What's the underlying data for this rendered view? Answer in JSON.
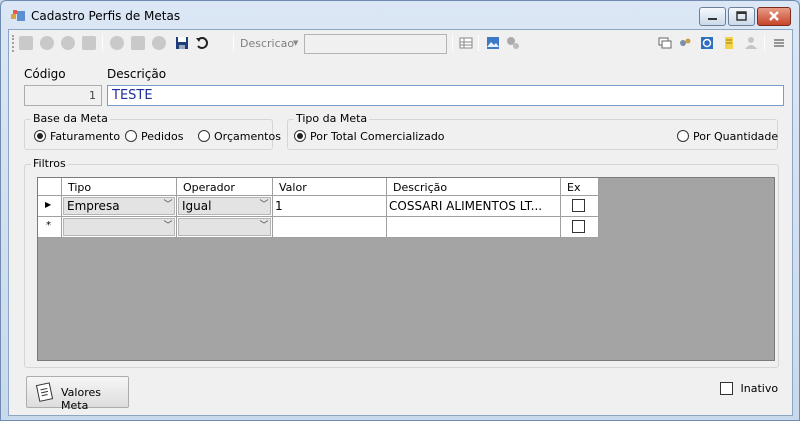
{
  "window": {
    "title": "Cadastro Perfis de Metas"
  },
  "toolbar": {
    "search_field_label": "Descricao",
    "search_field_value": ""
  },
  "form": {
    "codigo_label": "Código",
    "descricao_label": "Descrição",
    "codigo_value": "1",
    "descricao_value": "TESTE"
  },
  "base_meta": {
    "title": "Base da Meta",
    "options": [
      "Faturamento",
      "Pedidos",
      "Orçamentos"
    ],
    "selected": "Faturamento"
  },
  "tipo_meta": {
    "title": "Tipo da Meta",
    "options": [
      "Por Total Comercializado",
      "Por Quantidade"
    ],
    "selected": "Por Total Comercializado"
  },
  "filtros": {
    "title": "Filtros",
    "columns": [
      "Tipo",
      "Operador",
      "Valor",
      "Descrição",
      "Ex"
    ],
    "rows": [
      {
        "tipo": "Empresa",
        "operador": "Igual",
        "valor": "1",
        "descricao": "COSSARI ALIMENTOS LT...",
        "ex": false
      },
      {
        "tipo": "",
        "operador": "",
        "valor": "",
        "descricao": "",
        "ex": false
      }
    ]
  },
  "footer": {
    "valores_meta_label": "Valores Meta",
    "inativo_label": "Inativo",
    "inativo_checked": false
  },
  "colors": {
    "title_bar": "#c9d9ec",
    "grid_background": "#a4a4a4",
    "description_text": "#1d2d9f",
    "close_button": "#c6452a"
  }
}
